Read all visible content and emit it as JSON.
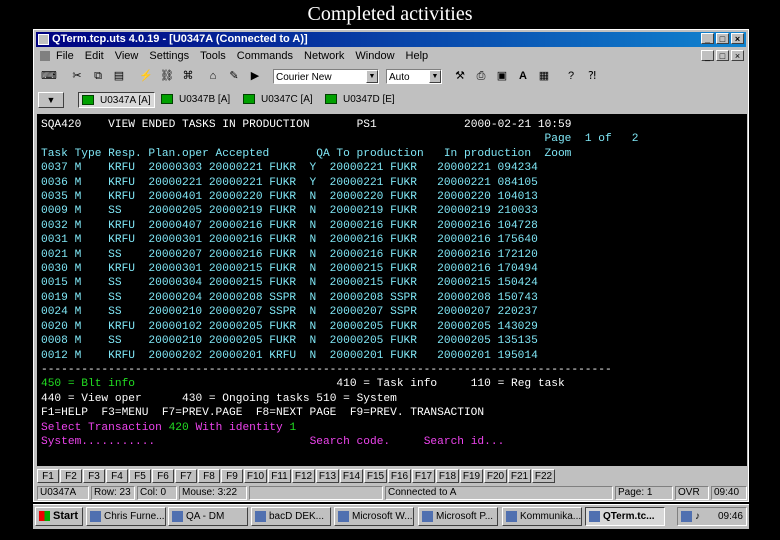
{
  "slide_title": "Completed activities",
  "window": {
    "title": "QTerm.tcp.uts 4.0.19 - [U0347A (Connected to A)]",
    "buttons": [
      "_",
      "□",
      "×"
    ]
  },
  "menu": [
    "File",
    "Edit",
    "View",
    "Settings",
    "Tools",
    "Commands",
    "Network",
    "Window",
    "Help"
  ],
  "toolbar": {
    "font_combo": "Courier New",
    "size_combo": "Auto"
  },
  "sessions": [
    "U0347A [A]",
    "U0347B [A]",
    "U0347C [A]",
    "U0347D [E]"
  ],
  "terminal": {
    "header": {
      "sqa": "SQA420",
      "heading": "VIEW ENDED TASKS IN PRODUCTION",
      "system": "PS1",
      "datetime": "2000-02-21 10:59",
      "page": "Page  1 of   2"
    },
    "columns": [
      "Task",
      "Type",
      "Resp.",
      "Plan.oper",
      "Accepted",
      "QA",
      "To production",
      "In production",
      "Zoom"
    ],
    "rows": [
      [
        "0037",
        "M",
        "KRFU",
        "20000303",
        "20000221 FUKR",
        "Y",
        "20000221 FUKR",
        "20000221 094234"
      ],
      [
        "0036",
        "M",
        "KRFU",
        "20000221",
        "20000221 FUKR",
        "Y",
        "20000221 FUKR",
        "20000221 084105"
      ],
      [
        "0035",
        "M",
        "KRFU",
        "20000401",
        "20000220 FUKR",
        "N",
        "20000220 FUKR",
        "20000220 104013"
      ],
      [
        "0009",
        "M",
        "SS",
        "20000205",
        "20000219 FUKR",
        "N",
        "20000219 FUKR",
        "20000219 210033"
      ],
      [
        "0032",
        "M",
        "KRFU",
        "20000407",
        "20000216 FUKR",
        "N",
        "20000216 FUKR",
        "20000216 104728"
      ],
      [
        "0031",
        "M",
        "KRFU",
        "20000301",
        "20000216 FUKR",
        "N",
        "20000216 FUKR",
        "20000216 175640"
      ],
      [
        "0021",
        "M",
        "SS",
        "20000207",
        "20000216 FUKR",
        "N",
        "20000216 FUKR",
        "20000216 172120"
      ],
      [
        "0030",
        "M",
        "KRFU",
        "20000301",
        "20000215 FUKR",
        "N",
        "20000215 FUKR",
        "20000216 170494"
      ],
      [
        "0015",
        "M",
        "SS",
        "20000304",
        "20000215 FUKR",
        "N",
        "20000215 FUKR",
        "20000215 150424"
      ],
      [
        "0019",
        "M",
        "SS",
        "20000204",
        "20000208 SSPR",
        "N",
        "20000208 SSPR",
        "20000208 150743"
      ],
      [
        "0024",
        "M",
        "SS",
        "20000210",
        "20000207 SSPR",
        "N",
        "20000207 SSPR",
        "20000207 220237"
      ],
      [
        "0020",
        "M",
        "KRFU",
        "20000102",
        "20000205 FUKR",
        "N",
        "20000205 FUKR",
        "20000205 143029"
      ],
      [
        "0008",
        "M",
        "SS",
        "20000210",
        "20000205 FUKR",
        "N",
        "20000205 FUKR",
        "20000205 135135"
      ],
      [
        "0012",
        "M",
        "KRFU",
        "20000202",
        "20000201 KRFU",
        "N",
        "20000201 FUKR",
        "20000201 195014"
      ]
    ],
    "separator": "-------------------------------------------------------------------------------------",
    "options": {
      "blt_info": "450 = Blt info",
      "task_info": "410 = Task info",
      "reg_task": "110 = Reg task",
      "view_oper": "440 = View oper",
      "ongoing": "430 = Ongoing tasks",
      "system": "510 = System"
    },
    "fkeys_line": "F1=HELP  F3=MENU  F7=PREV.PAGE  F8=NEXT PAGE  F9=PREV. TRANSACTION",
    "select": {
      "label": "Select Transaction",
      "transaction": "420",
      "with_identity": "With identity",
      "identity": "1"
    },
    "prompt": {
      "system": "System...........",
      "search_code": "Search code.",
      "search_id": "Search id..."
    }
  },
  "function_keys": [
    "F1",
    "F2",
    "F3",
    "F4",
    "F5",
    "F6",
    "F7",
    "F8",
    "F9",
    "F10",
    "F11",
    "F12",
    "F13",
    "F14",
    "F15",
    "F16",
    "F17",
    "F18",
    "F19",
    "F20",
    "F21",
    "F22"
  ],
  "statusbar": {
    "session": "U0347A",
    "row": "Row: 23",
    "col": "Col: 0",
    "mouse": "Mouse: 3:22",
    "connection": "Connected to A",
    "page": "Page: 1",
    "ovr": "OVR",
    "time": "09:40"
  },
  "taskbar": {
    "start": "Start",
    "items": [
      "Chris Furne...",
      "QA - DM",
      "bacD DEK...",
      "Microsoft W...",
      "Microsoft P...",
      "Kommunika...",
      "QTerm.tc..."
    ],
    "active_index": 6,
    "clock": "09:46"
  }
}
